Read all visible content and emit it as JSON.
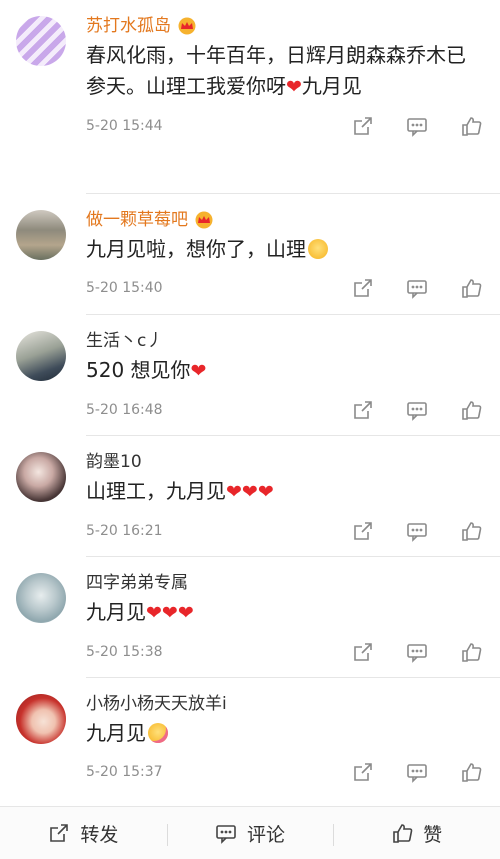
{
  "comments": [
    {
      "name": "苏打水孤岛",
      "vip": true,
      "text": "春风化雨，十年百年，日辉月朗森森乔木已参天。山理工我爱你呀",
      "suffix": "九月见",
      "time": "5-20 15:44"
    },
    {
      "name": "做一颗草莓吧",
      "vip": true,
      "text": "九月见啦，想你了，山理",
      "time": "5-20 15:40"
    },
    {
      "name": "生活丶c丿",
      "vip": false,
      "text": "520  想见你",
      "time": "5-20 16:48"
    },
    {
      "name": "韵墨10",
      "vip": false,
      "text": "山理工，九月见",
      "time": "5-20 16:21"
    },
    {
      "name": "四字弟弟专属",
      "vip": false,
      "text": "九月见",
      "time": "5-20 15:38"
    },
    {
      "name": "小杨小杨天天放羊i",
      "vip": false,
      "text": "九月见",
      "time": "5-20 15:37"
    }
  ],
  "bottom_bar": {
    "repost_label": "转发",
    "comment_label": "评论",
    "like_label": "赞"
  },
  "icons": [
    "share-icon",
    "reply-icon",
    "thumbs-up-icon",
    "crown-icon",
    "heart-emoji",
    "smile-emoji",
    "yum-emoji"
  ],
  "colors": {
    "vip_name": "#e3781e",
    "heart": "#e8262a",
    "meta": "#8e8e8e"
  }
}
